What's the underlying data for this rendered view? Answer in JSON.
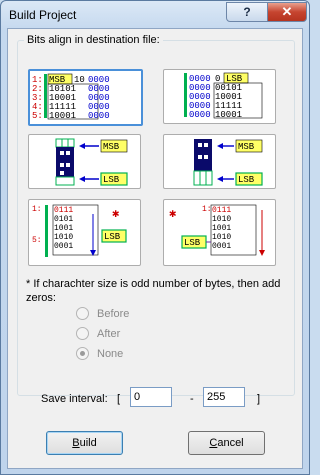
{
  "window": {
    "title": "Build Project",
    "help_glyph": "?",
    "close_glyph": "✕"
  },
  "group": {
    "legend": "Bits align in destination file:"
  },
  "tiles": {
    "row_nums": [
      "1:",
      "2:",
      "3:",
      "4:",
      "5:"
    ],
    "msb": "MSB",
    "lsb": "LSB",
    "grid_left": [
      "MSB10000",
      "00101000",
      "10001000",
      "11111000",
      "10001000"
    ],
    "grid_right": [
      "00000LSB",
      "00011000",
      "00010001",
      "00111111",
      "00010001"
    ],
    "star_glyph": "✱"
  },
  "note": {
    "text": "* If charachter size is odd number of bytes, then add zeros:"
  },
  "zeros_options": [
    {
      "label": "Before",
      "selected": false
    },
    {
      "label": "After",
      "selected": false
    },
    {
      "label": "None",
      "selected": true
    }
  ],
  "save_interval": {
    "label": "Save interval:",
    "open": "[",
    "dash": "-",
    "close": "]",
    "from": "0",
    "to": "255"
  },
  "buttons": {
    "build_first": "B",
    "build_rest": "uild",
    "cancel_first": "C",
    "cancel_rest": "ancel"
  },
  "colors": {
    "highlight": "#ffff66",
    "bar": "#00b050",
    "arrow": "#0000cc",
    "num": "#cc0000",
    "pixel": "#0a0a6a"
  }
}
